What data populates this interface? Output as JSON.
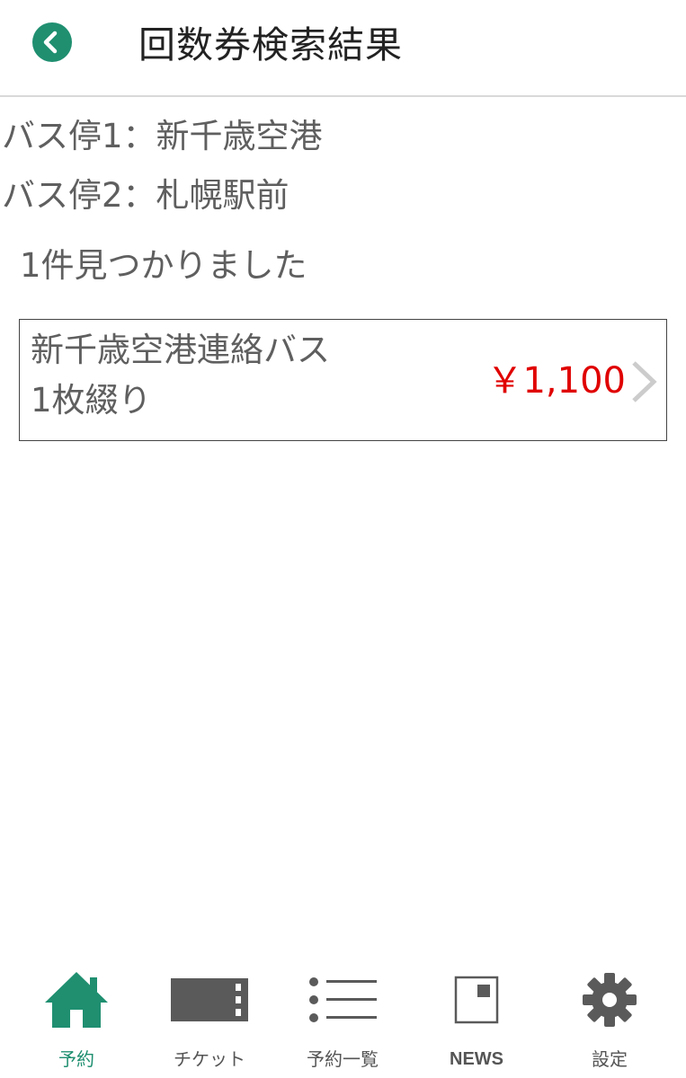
{
  "header": {
    "title": "回数券検索結果"
  },
  "search": {
    "stop1": "バス停1：新千歳空港",
    "stop2": "バス停2：札幌駅前",
    "count_text": "1件見つかりました"
  },
  "results": [
    {
      "name": "新千歳空港連絡バス",
      "type": "1枚綴り",
      "price": "￥1,100"
    }
  ],
  "tabbar": {
    "items": [
      {
        "label": "予約",
        "icon": "home-icon",
        "active": true
      },
      {
        "label": "チケット",
        "icon": "ticket-icon",
        "active": false
      },
      {
        "label": "予約一覧",
        "icon": "list-icon",
        "active": false
      },
      {
        "label": "NEWS",
        "icon": "news-icon",
        "active": false
      },
      {
        "label": "設定",
        "icon": "gear-icon",
        "active": false
      }
    ]
  },
  "colors": {
    "accent": "#1f8f70",
    "price": "#e00000",
    "text": "#5f5f5f",
    "icon_gray": "#5a5a5a"
  }
}
